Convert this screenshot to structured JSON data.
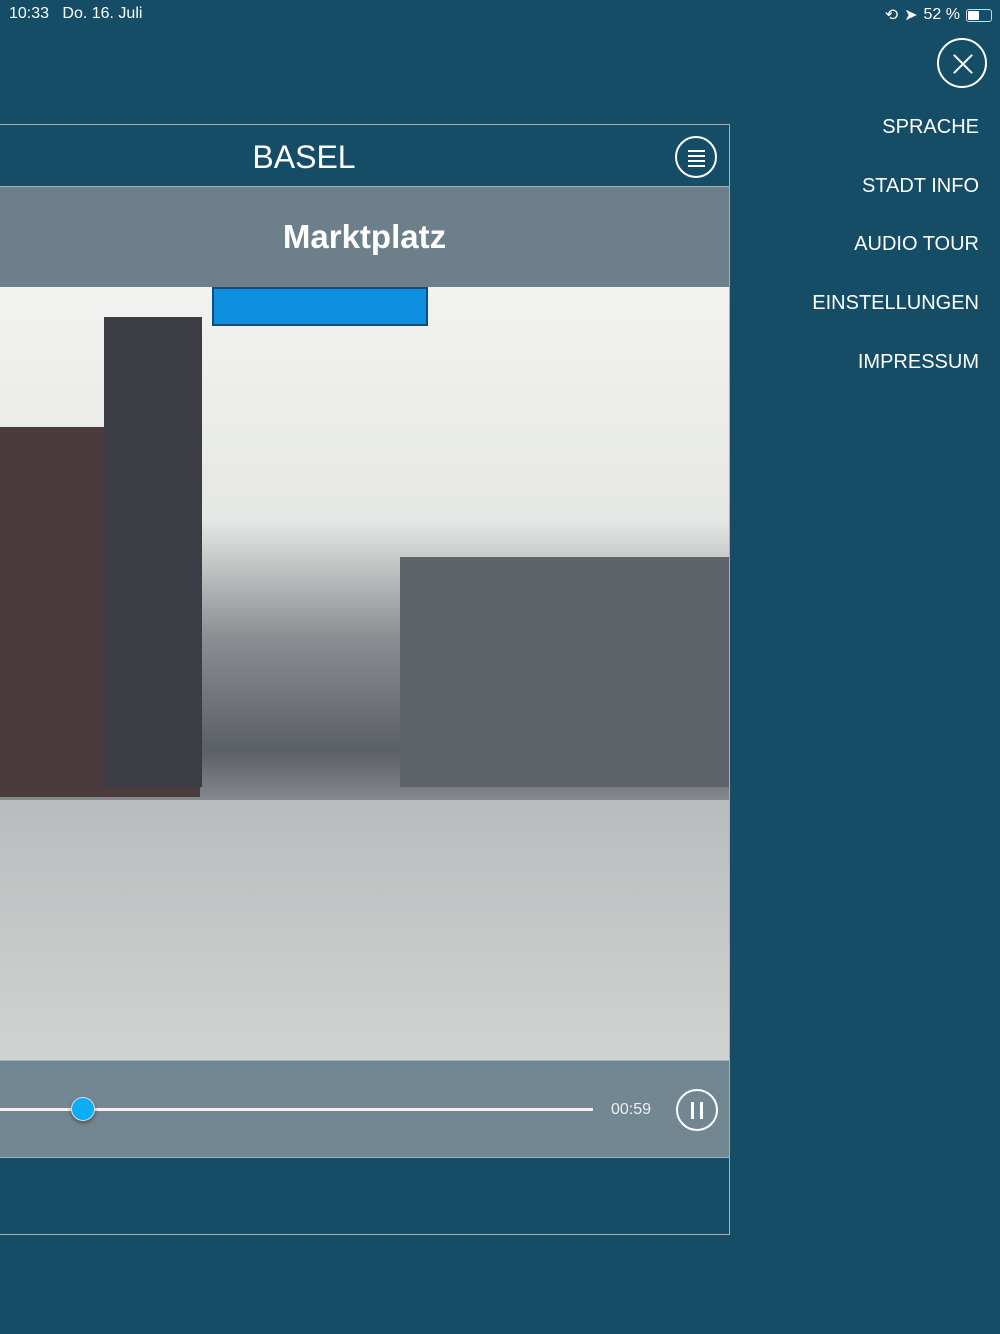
{
  "status": {
    "time": "10:33",
    "date": "Do. 16. Juli",
    "battery": "52 %",
    "battery_level": 0.52
  },
  "menu": {
    "items": [
      "SPRACHE",
      "STADT INFO",
      "AUDIO TOUR",
      "EINSTELLUNGEN",
      "IMPRESSUM"
    ]
  },
  "header": {
    "title": "BASEL"
  },
  "place": {
    "title": "Marktplatz"
  },
  "player": {
    "time": "00:59",
    "progress": 0.14
  },
  "colors": {
    "background": "#154d66",
    "panel": "#738792",
    "accent": "#0aaef5"
  }
}
